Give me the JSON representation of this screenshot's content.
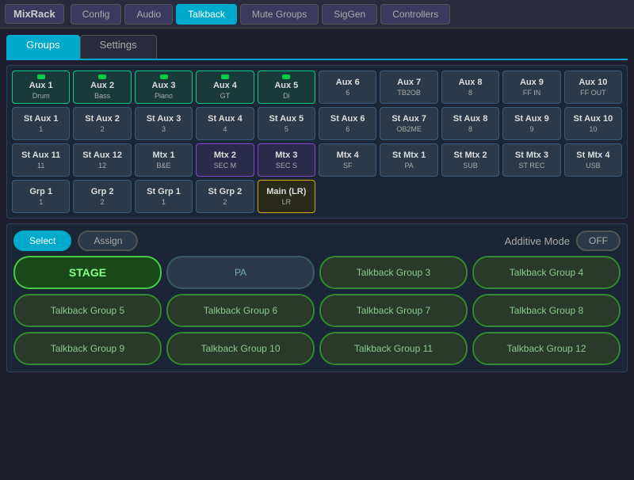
{
  "app": {
    "logo": "MixRack"
  },
  "top_tabs": [
    {
      "id": "config",
      "label": "Config",
      "active": false
    },
    {
      "id": "audio",
      "label": "Audio",
      "active": false
    },
    {
      "id": "talkback",
      "label": "Talkback",
      "active": true
    },
    {
      "id": "mute_groups",
      "label": "Mute Groups",
      "active": false
    },
    {
      "id": "siggen",
      "label": "SigGen",
      "active": false
    },
    {
      "id": "controllers",
      "label": "Controllers",
      "active": false
    }
  ],
  "sub_tabs": [
    {
      "id": "groups",
      "label": "Groups",
      "active": true
    },
    {
      "id": "settings",
      "label": "Settings",
      "active": false
    }
  ],
  "channel_rows": [
    {
      "channels": [
        {
          "name": "Aux 1",
          "sub": "Drum",
          "active": "green",
          "indicator": true
        },
        {
          "name": "Aux 2",
          "sub": "Bass",
          "active": "green",
          "indicator": true
        },
        {
          "name": "Aux 3",
          "sub": "Piano",
          "active": "green",
          "indicator": true
        },
        {
          "name": "Aux 4",
          "sub": "GT",
          "active": "green",
          "indicator": true
        },
        {
          "name": "Aux 5",
          "sub": "Di",
          "active": "green",
          "indicator": true
        },
        {
          "name": "Aux 6",
          "sub": "6",
          "active": "none"
        },
        {
          "name": "Aux 7",
          "sub": "TB2OB",
          "active": "none"
        },
        {
          "name": "Aux 8",
          "sub": "8",
          "active": "none"
        },
        {
          "name": "Aux 9",
          "sub": "FF IN",
          "active": "none"
        },
        {
          "name": "Aux 10",
          "sub": "FF OUT",
          "active": "none"
        }
      ]
    },
    {
      "channels": [
        {
          "name": "St Aux 1",
          "sub": "1",
          "active": "none"
        },
        {
          "name": "St Aux 2",
          "sub": "2",
          "active": "none"
        },
        {
          "name": "St Aux 3",
          "sub": "3",
          "active": "none"
        },
        {
          "name": "St Aux 4",
          "sub": "4",
          "active": "none"
        },
        {
          "name": "St Aux 5",
          "sub": "5",
          "active": "none"
        },
        {
          "name": "St Aux 6",
          "sub": "6",
          "active": "none"
        },
        {
          "name": "St Aux 7",
          "sub": "OB2ME",
          "active": "none"
        },
        {
          "name": "St Aux 8",
          "sub": "8",
          "active": "none"
        },
        {
          "name": "St Aux 9",
          "sub": "9",
          "active": "none"
        },
        {
          "name": "St Aux 10",
          "sub": "10",
          "active": "none"
        }
      ]
    },
    {
      "channels": [
        {
          "name": "St Aux 11",
          "sub": "11",
          "active": "none"
        },
        {
          "name": "St Aux 12",
          "sub": "12",
          "active": "none"
        },
        {
          "name": "Mtx 1",
          "sub": "B&E",
          "active": "none"
        },
        {
          "name": "Mtx 2",
          "sub": "SEC M",
          "active": "purple"
        },
        {
          "name": "Mtx 3",
          "sub": "SEC S",
          "active": "purple"
        },
        {
          "name": "Mtx 4",
          "sub": "SF",
          "active": "none"
        },
        {
          "name": "St Mtx 1",
          "sub": "PA",
          "active": "none"
        },
        {
          "name": "St Mtx 2",
          "sub": "SUB",
          "active": "none"
        },
        {
          "name": "St Mtx 3",
          "sub": "ST REC",
          "active": "none"
        },
        {
          "name": "St Mtx 4",
          "sub": "USB",
          "active": "none"
        }
      ]
    },
    {
      "channels": [
        {
          "name": "Grp 1",
          "sub": "1",
          "active": "none"
        },
        {
          "name": "Grp 2",
          "sub": "2",
          "active": "none"
        },
        {
          "name": "St Grp 1",
          "sub": "1",
          "active": "none"
        },
        {
          "name": "St Grp 2",
          "sub": "2",
          "active": "none"
        },
        {
          "name": "Main (LR)",
          "sub": "LR",
          "active": "gold"
        },
        {
          "name": "",
          "sub": "",
          "active": "hidden"
        },
        {
          "name": "",
          "sub": "",
          "active": "hidden"
        },
        {
          "name": "",
          "sub": "",
          "active": "hidden"
        },
        {
          "name": "",
          "sub": "",
          "active": "hidden"
        },
        {
          "name": "",
          "sub": "",
          "active": "hidden"
        }
      ]
    }
  ],
  "controls": {
    "select_label": "Select",
    "assign_label": "Assign",
    "additive_mode_label": "Additive Mode",
    "additive_mode_value": "OFF"
  },
  "talkback_groups": [
    {
      "id": "stage",
      "label": "STAGE",
      "style": "stage"
    },
    {
      "id": "pa",
      "label": "PA",
      "style": "inactive"
    },
    {
      "id": "tb3",
      "label": "Talkback Group 3",
      "style": "normal"
    },
    {
      "id": "tb4",
      "label": "Talkback Group 4",
      "style": "normal"
    },
    {
      "id": "tb5",
      "label": "Talkback Group 5",
      "style": "normal"
    },
    {
      "id": "tb6",
      "label": "Talkback Group 6",
      "style": "normal"
    },
    {
      "id": "tb7",
      "label": "Talkback Group 7",
      "style": "normal"
    },
    {
      "id": "tb8",
      "label": "Talkback Group 8",
      "style": "normal"
    },
    {
      "id": "tb9",
      "label": "Talkback Group 9",
      "style": "normal"
    },
    {
      "id": "tb10",
      "label": "Talkback Group 10",
      "style": "normal"
    },
    {
      "id": "tb11",
      "label": "Talkback Group 11",
      "style": "normal"
    },
    {
      "id": "tb12",
      "label": "Talkback Group 12",
      "style": "normal"
    }
  ]
}
